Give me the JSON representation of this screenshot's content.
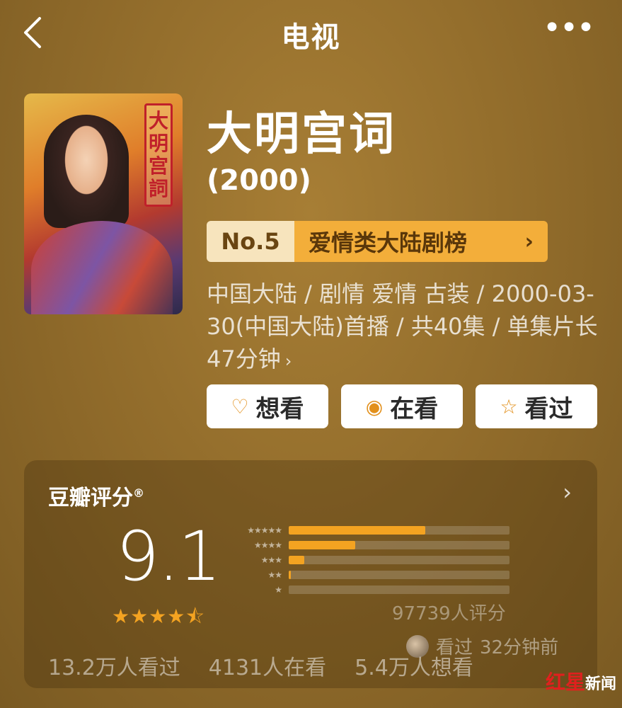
{
  "header": {
    "title": "电视",
    "back_icon": "chevron-left-icon",
    "more_icon": "more-horizontal-icon"
  },
  "poster": {
    "title_text": "大明宫词"
  },
  "show": {
    "name": "大明宫词",
    "year": "(2000)"
  },
  "rank": {
    "number": "No.5",
    "name": "爱情类大陆剧榜",
    "chevron": "›"
  },
  "meta": {
    "text": "中国大陆 / 剧情 爱情 古装 / 2000-03-30(中国大陆)首播 / 共40集 / 单集片长47分钟",
    "chevron": "›"
  },
  "actions": [
    {
      "label": "想看",
      "icon": "heart-plus-icon",
      "glyph": "♡"
    },
    {
      "label": "在看",
      "icon": "target-icon",
      "glyph": "◉"
    },
    {
      "label": "看过",
      "icon": "star-outline-icon",
      "glyph": "☆"
    }
  ],
  "rating": {
    "title": "豆瓣评分",
    "trademark": "®",
    "score": "9.1",
    "stars_display": "★★★★⯪",
    "star_value": 4.5,
    "distribution": [
      {
        "stars": "★★★★★",
        "fraction": 0.62
      },
      {
        "stars": "★★★★",
        "fraction": 0.3
      },
      {
        "stars": "★★★",
        "fraction": 0.07
      },
      {
        "stars": "★★",
        "fraction": 0.01
      },
      {
        "stars": "★",
        "fraction": 0.0
      }
    ],
    "count": "97739人评分"
  },
  "stats": {
    "watched": "13.2万人看过",
    "watching": "4131人在看",
    "want": "5.4万人想看"
  },
  "activity": {
    "action": "看过",
    "time": "32分钟前"
  },
  "watermark": {
    "red": "红星",
    "white": "新闻"
  },
  "colors": {
    "accent": "#f4a321",
    "background": "#8f6a2a",
    "rank_bg": "#f3ae3a"
  }
}
